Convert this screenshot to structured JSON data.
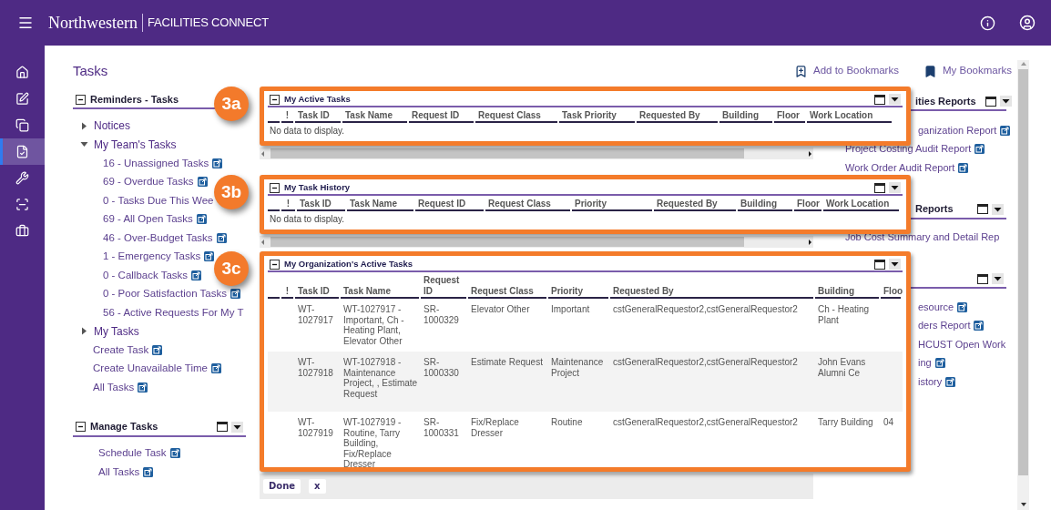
{
  "header": {
    "logo_name": "Northwestern",
    "logo_product": "FACILITIES CONNECT"
  },
  "rail": [
    {
      "kind": "home",
      "selected": false
    },
    {
      "kind": "edit",
      "selected": false
    },
    {
      "kind": "copy",
      "selected": false
    },
    {
      "kind": "task",
      "selected": true
    },
    {
      "kind": "wrench",
      "selected": false
    },
    {
      "kind": "scan",
      "selected": false
    },
    {
      "kind": "briefcase",
      "selected": false
    }
  ],
  "page_title": "Tasks",
  "bookmarks": [
    {
      "kind": "add",
      "label": "Add to Bookmarks"
    },
    {
      "kind": "list",
      "label": "My Bookmarks"
    }
  ],
  "left_sections": [
    {
      "title": "Reminders - Tasks",
      "tools": false,
      "items": [
        {
          "label": "Notices",
          "expanded": false
        },
        {
          "label": "My Team's Tasks",
          "expanded": true,
          "children": [
            {
              "label": "16 - Unassigned Tasks",
              "popup": true
            },
            {
              "label": "69 - Overdue Tasks",
              "popup": true
            },
            {
              "label": "0 - Tasks Due This Wee",
              "popup": false
            },
            {
              "label": "69 - All Open Tasks",
              "popup": true
            },
            {
              "label": "46 - Over-Budget Tasks",
              "popup": true
            },
            {
              "label": "1 - Emergency Tasks",
              "popup": true
            },
            {
              "label": "0 - Callback Tasks",
              "popup": true
            },
            {
              "label": "0 - Poor Satisfaction Tasks",
              "popup": true
            },
            {
              "label": "56 - Active Requests For My T",
              "popup": false
            }
          ]
        },
        {
          "label": "My Tasks",
          "expanded": false
        },
        {
          "label": "Create Task",
          "popup": true
        },
        {
          "label": "Create Unavailable Time",
          "popup": true
        },
        {
          "label": "All Tasks",
          "popup": true
        }
      ]
    },
    {
      "title": "Manage Tasks",
      "tools": true,
      "items": [
        {
          "label": "Schedule Task",
          "popup": true
        },
        {
          "label": "All Tasks",
          "popup": true
        }
      ]
    }
  ],
  "panels": [
    {
      "callout": "3a",
      "title": "My Active Tasks",
      "columns": [
        "!",
        "Task ID",
        "Task Name",
        "Request ID",
        "Request Class",
        "Task Priority",
        "Requested By",
        "Building",
        "Floor",
        "Work Location"
      ],
      "empty_text": "No data to display."
    },
    {
      "callout": "3b",
      "title": "My Task History",
      "columns": [
        "!",
        "Task ID",
        "Task Name",
        "Request ID",
        "Request Class",
        "Priority",
        "Requested By",
        "Building",
        "Floor",
        "Work Location"
      ],
      "empty_text": "No data to display."
    },
    {
      "callout": "3c",
      "title": "My Organization's Active Tasks",
      "columns": [
        "!",
        "Task ID",
        "Task Name",
        "Request ID",
        "Request Class",
        "Priority",
        "Requested By",
        "Building",
        "Floo"
      ],
      "buttons": [
        "Done",
        "x"
      ],
      "rows": [
        [
          "",
          "WT-1027917",
          "WT-1027917 - Important, Ch - Heating Plant, Elevator Other",
          "SR-1000329",
          "Elevator Other",
          "Important",
          "cstGeneralRequestor2,cstGeneralRequestor2",
          "Ch - Heating Plant",
          ""
        ],
        [
          "",
          "WT-1027918",
          "WT-1027918 - Maintenance Project, , Estimate Request",
          "SR-1000330",
          "Estimate Request",
          "Maintenance Project",
          "cstGeneralRequestor2,cstGeneralRequestor2",
          "John Evans Alumni Ce",
          ""
        ],
        [
          "",
          "WT-1027919",
          "WT-1027919 - Routine, Tarry Building, Fix/Replace Dresser",
          "SR-1000331",
          "Fix/Replace Dresser",
          "Routine",
          "cstGeneralRequestor2,cstGeneralRequestor2",
          "Tarry Building",
          "04"
        ]
      ]
    }
  ],
  "right_sections": [
    {
      "title": "ities Reports",
      "items": [
        {
          "label": "ganization Report",
          "cut": true,
          "popup": true
        },
        {
          "label": "Project Costing Audit Report",
          "cut": false,
          "popup": true
        },
        {
          "label": "Work Order Audit Report",
          "cut": false,
          "popup": true
        }
      ]
    },
    {
      "title": "Reports",
      "items": [
        {
          "label": "Job Cost Summary and Detail Rep",
          "cut": false,
          "popup": false
        }
      ]
    },
    {
      "items": [
        {
          "label": "esource",
          "cut": true,
          "popup": true
        },
        {
          "label": "ders Report",
          "cut": true,
          "popup": true
        },
        {
          "label": "HCUST Open Work",
          "cut": true,
          "popup": false
        },
        {
          "label": "ing",
          "cut": true,
          "popup": true
        },
        {
          "label": "istory",
          "cut": true,
          "popup": true
        }
      ]
    }
  ]
}
